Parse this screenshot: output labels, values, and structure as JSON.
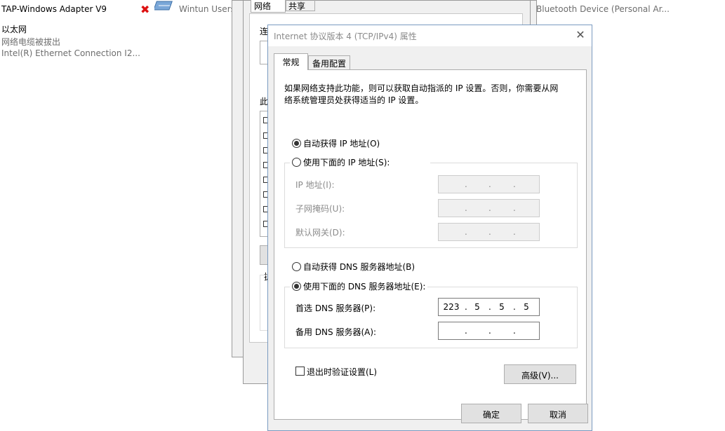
{
  "background": {
    "adapter_left_line": "TAP-Windows Adapter V9",
    "ethernet_name": "以太网",
    "ethernet_status": "网络电缆被拔出",
    "ethernet_device": "Intel(R) Ethernet Connection I2...",
    "wintun_device": "Wintun Users",
    "bluetooth_device": "Bluetooth Device (Personal Ar...",
    "back_dialog_tab_network": "网络",
    "back_dialog_tab_share": "共享",
    "back_dialog_label_connect": "连",
    "back_dialog_label_this": "此",
    "back_dialog_label_misc": "拢"
  },
  "dialog": {
    "title": "Internet 协议版本 4 (TCP/IPv4) 属性",
    "tabs": [
      "常规",
      "备用配置"
    ],
    "description_line1": "如果网络支持此功能，则可以获取自动指派的 IP 设置。否则，你需要从网",
    "description_line2": "络系统管理员处获得适当的 IP 设置。",
    "ip_auto_label": "自动获得 IP 地址(O)",
    "ip_manual_label": "使用下面的 IP 地址(S):",
    "ip_address_label": "IP 地址(I):",
    "subnet_label": "子网掩码(U):",
    "gateway_label": "默认网关(D):",
    "dns_auto_label": "自动获得 DNS 服务器地址(B)",
    "dns_manual_label": "使用下面的 DNS 服务器地址(E):",
    "preferred_dns_label": "首选 DNS 服务器(P):",
    "alternate_dns_label": "备用 DNS 服务器(A):",
    "preferred_dns": [
      "223",
      "5",
      "5",
      "5"
    ],
    "alternate_dns": [
      "",
      "",
      "",
      ""
    ],
    "validate_label": "退出时验证设置(L)",
    "advanced_button": "高级(V)...",
    "ok_button": "确定",
    "cancel_button": "取消",
    "selected_ip_mode": "auto",
    "selected_dns_mode": "manual",
    "validate_checked": false
  }
}
